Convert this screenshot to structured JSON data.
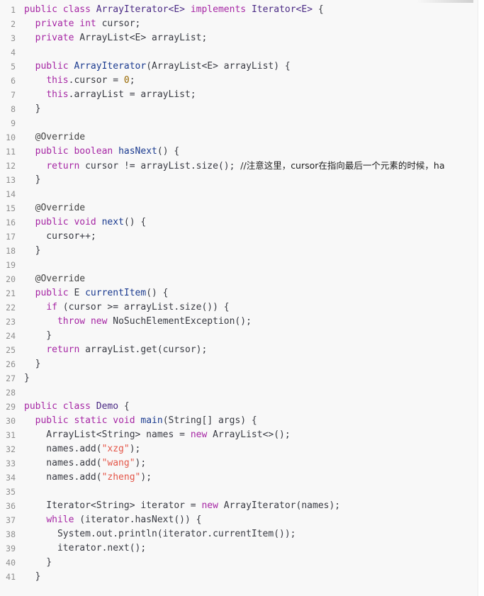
{
  "code": {
    "lines": [
      {
        "n": "1",
        "tokens": [
          {
            "t": "kw",
            "v": "public"
          },
          {
            "t": "p",
            "v": " "
          },
          {
            "t": "kw",
            "v": "class"
          },
          {
            "t": "p",
            "v": " "
          },
          {
            "t": "cls",
            "v": "ArrayIterator<E>"
          },
          {
            "t": "p",
            "v": " "
          },
          {
            "t": "kw",
            "v": "implements"
          },
          {
            "t": "p",
            "v": " "
          },
          {
            "t": "cls",
            "v": "Iterator<E>"
          },
          {
            "t": "p",
            "v": " {"
          }
        ]
      },
      {
        "n": "2",
        "tokens": [
          {
            "t": "p",
            "v": "  "
          },
          {
            "t": "kw",
            "v": "private"
          },
          {
            "t": "p",
            "v": " "
          },
          {
            "t": "kw",
            "v": "int"
          },
          {
            "t": "p",
            "v": " cursor;"
          }
        ]
      },
      {
        "n": "3",
        "tokens": [
          {
            "t": "p",
            "v": "  "
          },
          {
            "t": "kw",
            "v": "private"
          },
          {
            "t": "p",
            "v": " ArrayList<E> arrayList;"
          }
        ]
      },
      {
        "n": "4",
        "tokens": []
      },
      {
        "n": "5",
        "tokens": [
          {
            "t": "p",
            "v": "  "
          },
          {
            "t": "kw",
            "v": "public"
          },
          {
            "t": "p",
            "v": " "
          },
          {
            "t": "fn",
            "v": "ArrayIterator"
          },
          {
            "t": "p",
            "v": "(ArrayList<E> arrayList) {"
          }
        ]
      },
      {
        "n": "6",
        "tokens": [
          {
            "t": "p",
            "v": "    "
          },
          {
            "t": "kw",
            "v": "this"
          },
          {
            "t": "p",
            "v": ".cursor = "
          },
          {
            "t": "num",
            "v": "0"
          },
          {
            "t": "p",
            "v": ";"
          }
        ]
      },
      {
        "n": "7",
        "tokens": [
          {
            "t": "p",
            "v": "    "
          },
          {
            "t": "kw",
            "v": "this"
          },
          {
            "t": "p",
            "v": ".arrayList = arrayList;"
          }
        ]
      },
      {
        "n": "8",
        "tokens": [
          {
            "t": "p",
            "v": "  }"
          }
        ]
      },
      {
        "n": "9",
        "tokens": []
      },
      {
        "n": "10",
        "tokens": [
          {
            "t": "p",
            "v": "  "
          },
          {
            "t": "ann",
            "v": "@Override"
          }
        ]
      },
      {
        "n": "11",
        "tokens": [
          {
            "t": "p",
            "v": "  "
          },
          {
            "t": "kw",
            "v": "public"
          },
          {
            "t": "p",
            "v": " "
          },
          {
            "t": "kw",
            "v": "boolean"
          },
          {
            "t": "p",
            "v": " "
          },
          {
            "t": "fn",
            "v": "hasNext"
          },
          {
            "t": "p",
            "v": "() {"
          }
        ]
      },
      {
        "n": "12",
        "tokens": [
          {
            "t": "p",
            "v": "    "
          },
          {
            "t": "kw",
            "v": "return"
          },
          {
            "t": "p",
            "v": " cursor != arrayList.size(); "
          },
          {
            "t": "cmt",
            "v": "//注意这里，cursor在指向最后一个元素的时候，ha"
          }
        ]
      },
      {
        "n": "13",
        "tokens": [
          {
            "t": "p",
            "v": "  }"
          }
        ]
      },
      {
        "n": "14",
        "tokens": []
      },
      {
        "n": "15",
        "tokens": [
          {
            "t": "p",
            "v": "  "
          },
          {
            "t": "ann",
            "v": "@Override"
          }
        ]
      },
      {
        "n": "16",
        "tokens": [
          {
            "t": "p",
            "v": "  "
          },
          {
            "t": "kw",
            "v": "public"
          },
          {
            "t": "p",
            "v": " "
          },
          {
            "t": "kw",
            "v": "void"
          },
          {
            "t": "p",
            "v": " "
          },
          {
            "t": "fn",
            "v": "next"
          },
          {
            "t": "p",
            "v": "() {"
          }
        ]
      },
      {
        "n": "17",
        "tokens": [
          {
            "t": "p",
            "v": "    cursor++;"
          }
        ]
      },
      {
        "n": "18",
        "tokens": [
          {
            "t": "p",
            "v": "  }"
          }
        ]
      },
      {
        "n": "19",
        "tokens": []
      },
      {
        "n": "20",
        "tokens": [
          {
            "t": "p",
            "v": "  "
          },
          {
            "t": "ann",
            "v": "@Override"
          }
        ]
      },
      {
        "n": "21",
        "tokens": [
          {
            "t": "p",
            "v": "  "
          },
          {
            "t": "kw",
            "v": "public"
          },
          {
            "t": "p",
            "v": " E "
          },
          {
            "t": "fn",
            "v": "currentItem"
          },
          {
            "t": "p",
            "v": "() {"
          }
        ]
      },
      {
        "n": "22",
        "tokens": [
          {
            "t": "p",
            "v": "    "
          },
          {
            "t": "kw",
            "v": "if"
          },
          {
            "t": "p",
            "v": " (cursor >= arrayList.size()) {"
          }
        ]
      },
      {
        "n": "23",
        "tokens": [
          {
            "t": "p",
            "v": "      "
          },
          {
            "t": "kw",
            "v": "throw"
          },
          {
            "t": "p",
            "v": " "
          },
          {
            "t": "kw",
            "v": "new"
          },
          {
            "t": "p",
            "v": " NoSuchElementException();"
          }
        ]
      },
      {
        "n": "24",
        "tokens": [
          {
            "t": "p",
            "v": "    }"
          }
        ]
      },
      {
        "n": "25",
        "tokens": [
          {
            "t": "p",
            "v": "    "
          },
          {
            "t": "kw",
            "v": "return"
          },
          {
            "t": "p",
            "v": " arrayList.get(cursor);"
          }
        ]
      },
      {
        "n": "26",
        "tokens": [
          {
            "t": "p",
            "v": "  }"
          }
        ]
      },
      {
        "n": "27",
        "tokens": [
          {
            "t": "p",
            "v": "}"
          }
        ]
      },
      {
        "n": "28",
        "tokens": []
      },
      {
        "n": "29",
        "tokens": [
          {
            "t": "kw",
            "v": "public"
          },
          {
            "t": "p",
            "v": " "
          },
          {
            "t": "kw",
            "v": "class"
          },
          {
            "t": "p",
            "v": " "
          },
          {
            "t": "cls",
            "v": "Demo"
          },
          {
            "t": "p",
            "v": " {"
          }
        ]
      },
      {
        "n": "30",
        "tokens": [
          {
            "t": "p",
            "v": "  "
          },
          {
            "t": "kw",
            "v": "public"
          },
          {
            "t": "p",
            "v": " "
          },
          {
            "t": "kw",
            "v": "static"
          },
          {
            "t": "p",
            "v": " "
          },
          {
            "t": "kw",
            "v": "void"
          },
          {
            "t": "p",
            "v": " "
          },
          {
            "t": "fn",
            "v": "main"
          },
          {
            "t": "p",
            "v": "(String[] args) {"
          }
        ]
      },
      {
        "n": "31",
        "tokens": [
          {
            "t": "p",
            "v": "    ArrayList<String> names = "
          },
          {
            "t": "kw",
            "v": "new"
          },
          {
            "t": "p",
            "v": " ArrayList<>();"
          }
        ]
      },
      {
        "n": "32",
        "tokens": [
          {
            "t": "p",
            "v": "    names.add("
          },
          {
            "t": "str",
            "v": "\"xzg\""
          },
          {
            "t": "p",
            "v": ");"
          }
        ]
      },
      {
        "n": "33",
        "tokens": [
          {
            "t": "p",
            "v": "    names.add("
          },
          {
            "t": "str",
            "v": "\"wang\""
          },
          {
            "t": "p",
            "v": ");"
          }
        ]
      },
      {
        "n": "34",
        "tokens": [
          {
            "t": "p",
            "v": "    names.add("
          },
          {
            "t": "str",
            "v": "\"zheng\""
          },
          {
            "t": "p",
            "v": ");"
          }
        ]
      },
      {
        "n": "35",
        "tokens": []
      },
      {
        "n": "36",
        "tokens": [
          {
            "t": "p",
            "v": "    Iterator<String> iterator = "
          },
          {
            "t": "kw",
            "v": "new"
          },
          {
            "t": "p",
            "v": " ArrayIterator(names);"
          }
        ]
      },
      {
        "n": "37",
        "tokens": [
          {
            "t": "p",
            "v": "    "
          },
          {
            "t": "kw",
            "v": "while"
          },
          {
            "t": "p",
            "v": " (iterator.hasNext()) {"
          }
        ]
      },
      {
        "n": "38",
        "tokens": [
          {
            "t": "p",
            "v": "      System.out.println(iterator.currentItem());"
          }
        ]
      },
      {
        "n": "39",
        "tokens": [
          {
            "t": "p",
            "v": "      iterator.next();"
          }
        ]
      },
      {
        "n": "40",
        "tokens": [
          {
            "t": "p",
            "v": "    }"
          }
        ]
      },
      {
        "n": "41",
        "tokens": [
          {
            "t": "p",
            "v": "  }"
          }
        ]
      }
    ]
  }
}
